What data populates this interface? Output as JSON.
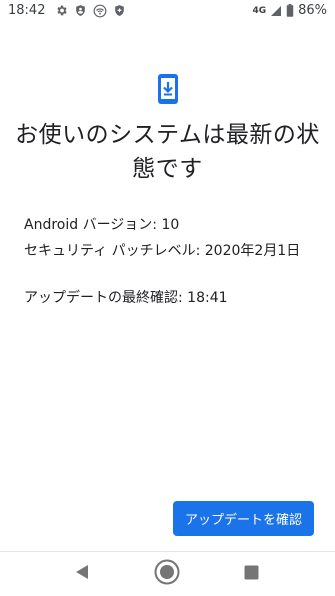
{
  "status_bar": {
    "time": "18:42",
    "network": "4G",
    "battery": "86%"
  },
  "main": {
    "title": "お使いのシステムは最新の状態です",
    "android_version": "Android バージョン: 10",
    "security_patch": "セキュリティ パッチレベル: 2020年2月1日",
    "last_checked": "アップデートの最終確認: 18:41"
  },
  "actions": {
    "check_update_label": "アップデートを確認"
  },
  "colors": {
    "accent": "#1a73e8",
    "text": "#202124",
    "nav_icon": "#757575"
  },
  "icons": {
    "status_left": [
      "gear-icon",
      "shield-icon",
      "wifi-icon",
      "shield-plus-icon"
    ],
    "status_right": [
      "signal-icon",
      "battery-icon"
    ],
    "hero": "phone-download-icon",
    "nav": [
      "back-icon",
      "home-icon",
      "recents-icon"
    ]
  }
}
